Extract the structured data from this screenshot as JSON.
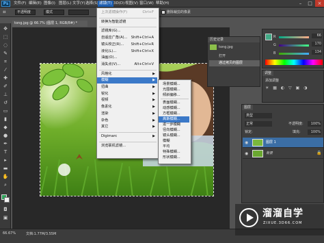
{
  "menubar": {
    "logo": "Ps",
    "items": [
      "文件(F)",
      "编辑(E)",
      "图像(I)",
      "图层(L)",
      "文字(Y)",
      "选择(S)",
      "滤镜(T)",
      "3D(D)",
      "视图(V)",
      "窗口(W)",
      "帮助(H)"
    ],
    "active_index": 6,
    "window_buttons": [
      "–",
      "□",
      "×"
    ]
  },
  "options_bar": {
    "fields": [
      "不透明度",
      "模式",
      ""
    ],
    "checkbox_label": "删除裁剪的像素"
  },
  "document": {
    "tab_title": "tong.jpg @ 66.7% (图层 1, RGB/8#) *",
    "zoom": "66.67%",
    "doc_info": "文档:1.77M/3.55M"
  },
  "filter_menu": {
    "items": [
      {
        "label": "上次滤镜操作(F)",
        "shortcut": "Ctrl+F",
        "disabled": true
      },
      {
        "sep": true
      },
      {
        "label": "转换为智能滤镜",
        "shortcut": ""
      },
      {
        "sep": true
      },
      {
        "label": "滤镜库(G)...",
        "shortcut": ""
      },
      {
        "label": "自适应广角(A)...",
        "shortcut": "Shift+Ctrl+A"
      },
      {
        "label": "镜头校正(R)...",
        "shortcut": "Shift+Ctrl+R"
      },
      {
        "label": "液化(L)...",
        "shortcut": "Shift+Ctrl+X"
      },
      {
        "label": "油画(O)...",
        "shortcut": ""
      },
      {
        "label": "消失点(V)...",
        "shortcut": "Alt+Ctrl+V"
      },
      {
        "sep": true
      },
      {
        "label": "风格化",
        "submenu": true
      },
      {
        "label": "模糊",
        "submenu": true,
        "selected": true
      },
      {
        "label": "扭曲",
        "submenu": true
      },
      {
        "label": "锐化",
        "submenu": true
      },
      {
        "label": "视频",
        "submenu": true
      },
      {
        "label": "像素化",
        "submenu": true
      },
      {
        "label": "渲染",
        "submenu": true
      },
      {
        "label": "杂色",
        "submenu": true
      },
      {
        "label": "其它",
        "submenu": true
      },
      {
        "sep": true
      },
      {
        "label": "Digimarc",
        "submenu": true
      },
      {
        "sep": true
      },
      {
        "label": "浏览联机滤镜...",
        "shortcut": ""
      }
    ]
  },
  "blur_submenu": {
    "items": [
      {
        "label": "场景模糊..."
      },
      {
        "label": "光圈模糊..."
      },
      {
        "label": "倾斜偏移..."
      },
      {
        "sep": true
      },
      {
        "label": "表面模糊..."
      },
      {
        "label": "动感模糊..."
      },
      {
        "label": "方框模糊..."
      },
      {
        "label": "高斯模糊...",
        "selected": true
      },
      {
        "label": "进一步模糊"
      },
      {
        "label": "径向模糊..."
      },
      {
        "label": "镜头模糊..."
      },
      {
        "label": "模糊"
      },
      {
        "label": "平均"
      },
      {
        "label": "特殊模糊..."
      },
      {
        "label": "形状模糊..."
      }
    ]
  },
  "history_panel": {
    "title": "历史记录",
    "snapshot": "tong.jpg",
    "steps": [
      "打开",
      "通过拷贝的图层"
    ]
  },
  "color_panel": {
    "values": [
      "66",
      "170",
      "134"
    ],
    "slider_letters": [
      "R",
      "G",
      "B"
    ]
  },
  "adjust_panel": {
    "title": "调整",
    "sub": "添加调整"
  },
  "layers_panel": {
    "tab": "图层",
    "kind": "类型",
    "blend": "正常",
    "opacity_label": "不透明度:",
    "opacity": "100%",
    "lock_label": "锁定:",
    "fill_label": "填充:",
    "fill": "100%",
    "layers": [
      {
        "name": "图层 1",
        "selected": true
      },
      {
        "name": "背景",
        "selected": false
      }
    ]
  },
  "watermark": {
    "name": "溜溜自学",
    "url": "ZIXUE.3D66.COM"
  },
  "colors": {
    "menu_highlight": "#3b79c8",
    "ui_dark": "#3c3c3c"
  }
}
